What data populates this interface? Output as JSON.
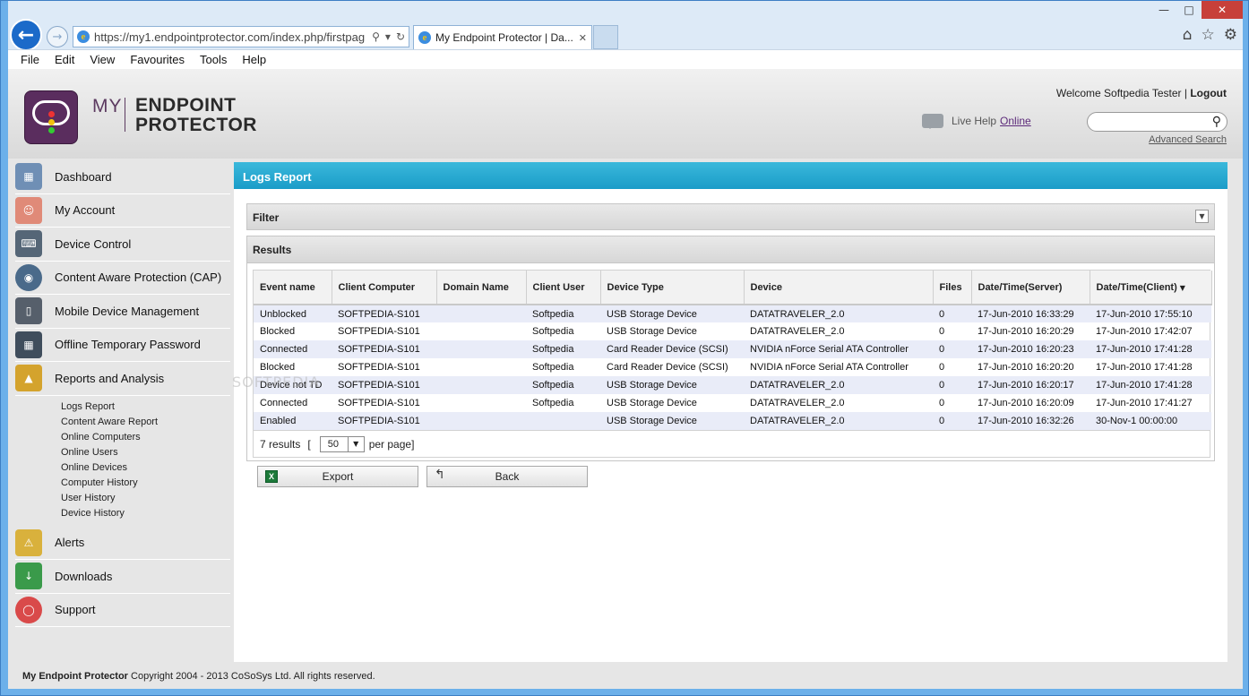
{
  "browser": {
    "url": "https://my1.endpointprotector.com/index.php/firstpag",
    "tab_title": "My Endpoint Protector | Da...",
    "menu": [
      "File",
      "Edit",
      "View",
      "Favourites",
      "Tools",
      "Help"
    ]
  },
  "header": {
    "logo_my": "MY",
    "logo_line1": "ENDPOINT",
    "logo_line2": "PROTECTOR",
    "welcome_text": "Welcome Softpedia Tester",
    "separator": "|",
    "logout": "Logout",
    "live_help_label": "Live Help",
    "live_help_status": "Online",
    "search_placeholder": "",
    "advanced_search": "Advanced Search"
  },
  "sidebar": {
    "items": [
      {
        "label": "Dashboard",
        "icon": "dashboard-icon",
        "color": "#6f8fb5"
      },
      {
        "label": "My Account",
        "icon": "user-icon",
        "color": "#e08a78"
      },
      {
        "label": "Device Control",
        "icon": "device-control-icon",
        "color": "#556677"
      },
      {
        "label": "Content Aware Protection (CAP)",
        "icon": "cap-icon",
        "color": "#4a6a8a"
      },
      {
        "label": "Mobile Device Management",
        "icon": "tablet-icon",
        "color": "#565f6b"
      },
      {
        "label": "Offline Temporary Password",
        "icon": "calculator-icon",
        "color": "#3f4d5c"
      },
      {
        "label": "Reports and Analysis",
        "icon": "chart-icon",
        "color": "#d4a32d"
      }
    ],
    "subitems": [
      "Logs Report",
      "Content Aware Report",
      "Online Computers",
      "Online Users",
      "Online Devices",
      "Computer History",
      "User History",
      "Device History"
    ],
    "items_after": [
      {
        "label": "Alerts",
        "icon": "alert-icon",
        "color": "#d9b13c"
      },
      {
        "label": "Downloads",
        "icon": "download-icon",
        "color": "#3a9a4a"
      },
      {
        "label": "Support",
        "icon": "lifebuoy-icon",
        "color": "#d94a4a"
      }
    ]
  },
  "content": {
    "title": "Logs Report",
    "filter_label": "Filter",
    "results_label": "Results",
    "columns": [
      "Event name",
      "Client Computer",
      "Domain Name",
      "Client User",
      "Device Type",
      "Device",
      "Files",
      "Date/Time(Server)",
      "Date/Time(Client)"
    ],
    "rows": [
      [
        "Unblocked",
        "SOFTPEDIA-S101",
        "",
        "Softpedia",
        "USB Storage Device",
        "DATATRAVELER_2.0",
        "0",
        "17-Jun-2010 16:33:29",
        "17-Jun-2010 17:55:10"
      ],
      [
        "Blocked",
        "SOFTPEDIA-S101",
        "",
        "Softpedia",
        "USB Storage Device",
        "DATATRAVELER_2.0",
        "0",
        "17-Jun-2010 16:20:29",
        "17-Jun-2010 17:42:07"
      ],
      [
        "Connected",
        "SOFTPEDIA-S101",
        "",
        "Softpedia",
        "Card Reader Device (SCSI)",
        "NVIDIA nForce Serial ATA Controller",
        "0",
        "17-Jun-2010 16:20:23",
        "17-Jun-2010 17:41:28"
      ],
      [
        "Blocked",
        "SOFTPEDIA-S101",
        "",
        "Softpedia",
        "Card Reader Device (SCSI)",
        "NVIDIA nForce Serial ATA Controller",
        "0",
        "17-Jun-2010 16:20:20",
        "17-Jun-2010 17:41:28"
      ],
      [
        "Device not TD",
        "SOFTPEDIA-S101",
        "",
        "Softpedia",
        "USB Storage Device",
        "DATATRAVELER_2.0",
        "0",
        "17-Jun-2010 16:20:17",
        "17-Jun-2010 17:41:28"
      ],
      [
        "Connected",
        "SOFTPEDIA-S101",
        "",
        "Softpedia",
        "USB Storage Device",
        "DATATRAVELER_2.0",
        "0",
        "17-Jun-2010 16:20:09",
        "17-Jun-2010 17:41:27"
      ],
      [
        "Enabled",
        "SOFTPEDIA-S101",
        "",
        "",
        "USB Storage Device",
        "DATATRAVELER_2.0",
        "0",
        "17-Jun-2010 16:32:26",
        "30-Nov-1 00:00:00"
      ]
    ],
    "results_count": "7 results",
    "pager_open": "[",
    "per_page_value": "50",
    "pager_close": "per page]",
    "export_label": "Export",
    "back_label": "Back"
  },
  "footer": {
    "brand": "My Endpoint Protector",
    "text": "Copyright 2004 - 2013 CoSoSys Ltd. All rights reserved."
  },
  "watermark": "SOFTPEDIA"
}
